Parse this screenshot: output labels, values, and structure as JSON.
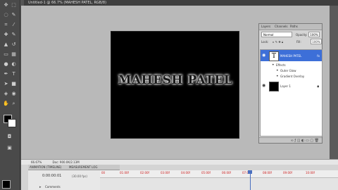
{
  "document": {
    "tab_title": "Untitled-1 @ 66.7% (MAHESH PATEL, RGB/8)"
  },
  "canvas": {
    "text": "MAHESH PATEL"
  },
  "layers_panel": {
    "tabs": [
      "Layers",
      "Channels",
      "Paths"
    ],
    "blend_mode": "Normal",
    "opacity_label": "Opacity:",
    "opacity_value": "100%",
    "lock_label": "Lock:",
    "fill_label": "Fill:",
    "fill_value": "100%",
    "layers": [
      {
        "name": "MAHESH PATEL",
        "fx": "fx",
        "effects_label": "Effects",
        "effects": [
          "Outer Glow",
          "Gradient Overlay"
        ]
      },
      {
        "name": "Layer 1"
      }
    ]
  },
  "status_bar": {
    "zoom": "66.67%",
    "doc_info": "Doc: 900.0K/2.13M"
  },
  "timeline": {
    "tabs": [
      "ANIMATION (TIMELINE)",
      "MEASUREMENT LOG"
    ],
    "time": "0:00:00:01",
    "fps": "(30.00 fps)",
    "ticks": [
      "00",
      "01:00f",
      "02:00f",
      "03:00f",
      "04:00f",
      "05:00f",
      "06:00f",
      "07:00f",
      "08:00f",
      "09:00f",
      "10:00f"
    ],
    "row_label": "Comments"
  }
}
